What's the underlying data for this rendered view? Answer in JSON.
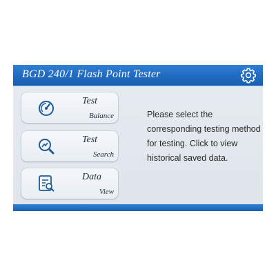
{
  "header": {
    "title": "BGD 240/1 Flash Point Tester",
    "settings_icon": "gear-icon"
  },
  "menu": [
    {
      "main": "Test",
      "sub": "Balance",
      "icon": "gauge-icon"
    },
    {
      "main": "Test",
      "sub": "Search",
      "icon": "magnifier-chart-icon"
    },
    {
      "main": "Data",
      "sub": "View",
      "icon": "document-search-icon"
    }
  ],
  "instruction": "Please select the corresponding testing method for testing. Click to view historical saved data.",
  "colors": {
    "header_blue": "#1f6ac0",
    "background": "#e2e8ee",
    "icon_blue": "#1e5a96"
  }
}
